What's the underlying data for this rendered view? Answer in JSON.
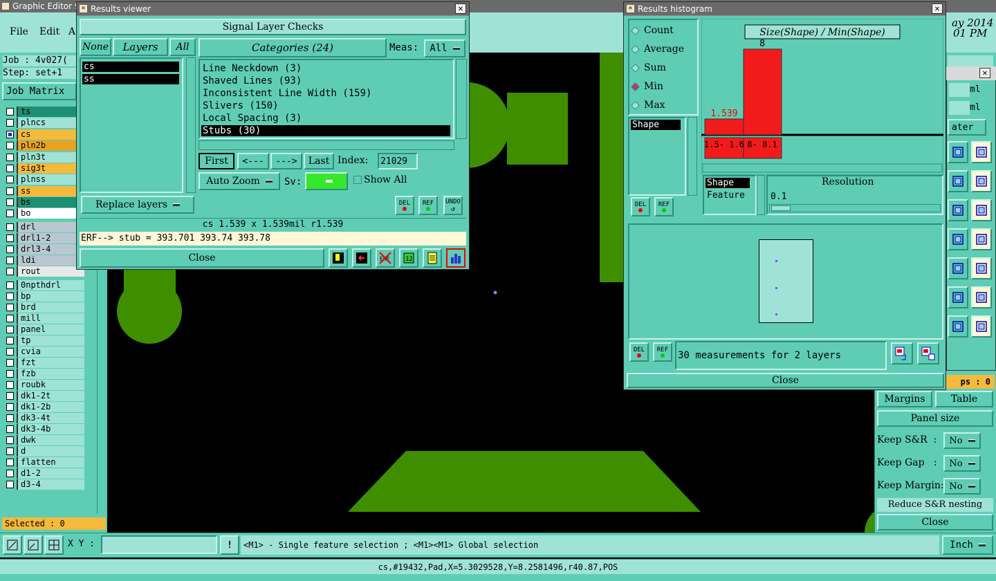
{
  "main": {
    "title": "Graphic Editor 9",
    "menu": [
      "File",
      "Edit",
      "A"
    ],
    "job": "Job : 4v027(",
    "step": "Step: set+1",
    "job_matrix": "Job Matrix",
    "selected": "Selected : 0",
    "date_fragment": "ay 2014",
    "time_fragment": "01 PM",
    "layers": [
      {
        "name": "ts",
        "color": "#1f8f73",
        "checked": false
      },
      {
        "name": "plncs",
        "color": "#9ee3d6",
        "checked": false
      },
      {
        "name": "cs",
        "color": "#f5b93c",
        "checked": true
      },
      {
        "name": "pln2b",
        "color": "#e8a323",
        "checked": false
      },
      {
        "name": "pln3t",
        "color": "#9ee3d6",
        "checked": false
      },
      {
        "name": "sig3t",
        "color": "#f5b93c",
        "checked": false
      },
      {
        "name": "plnss",
        "color": "#9ee3d6",
        "checked": false
      },
      {
        "name": "ss",
        "color": "#f5b93c",
        "checked": false
      },
      {
        "name": "bs",
        "color": "#1f8f73",
        "checked": false
      },
      {
        "name": "bo",
        "color": "#ffffff",
        "checked": false
      },
      {
        "name": "drl",
        "color": "#b9c8d0",
        "checked": false
      },
      {
        "name": "drl1-2",
        "color": "#b9c8d0",
        "checked": false
      },
      {
        "name": "drl3-4",
        "color": "#b9c8d0",
        "checked": false
      },
      {
        "name": "ldi",
        "color": "#b9c8d0",
        "checked": false
      },
      {
        "name": "rout",
        "color": "#e8e8e8",
        "checked": false
      },
      {
        "name": "0npthdrl",
        "color": "#9ee3d6",
        "checked": false
      },
      {
        "name": "bp",
        "color": "#9ee3d6",
        "checked": false
      },
      {
        "name": "brd",
        "color": "#9ee3d6",
        "checked": false
      },
      {
        "name": "mill",
        "color": "#9ee3d6",
        "checked": false
      },
      {
        "name": "panel",
        "color": "#9ee3d6",
        "checked": false
      },
      {
        "name": "tp",
        "color": "#9ee3d6",
        "checked": false
      },
      {
        "name": "cvia",
        "color": "#9ee3d6",
        "checked": false
      },
      {
        "name": "fzt",
        "color": "#9ee3d6",
        "checked": false
      },
      {
        "name": "fzb",
        "color": "#9ee3d6",
        "checked": false
      },
      {
        "name": "roubk",
        "color": "#9ee3d6",
        "checked": false
      },
      {
        "name": "dk1-2t",
        "color": "#9ee3d6",
        "checked": false
      },
      {
        "name": "dk1-2b",
        "color": "#9ee3d6",
        "checked": false
      },
      {
        "name": "dk3-4t",
        "color": "#9ee3d6",
        "checked": false
      },
      {
        "name": "dk3-4b",
        "color": "#9ee3d6",
        "checked": false
      },
      {
        "name": "dwk",
        "color": "#9ee3d6",
        "checked": false
      },
      {
        "name": "d",
        "color": "#9ee3d6",
        "checked": false
      },
      {
        "name": "flatten",
        "color": "#9ee3d6",
        "checked": false
      },
      {
        "name": "d1-2",
        "color": "#9ee3d6",
        "checked": false
      },
      {
        "name": "d3-4",
        "color": "#9ee3d6",
        "checked": false
      }
    ],
    "xy_label": "X Y :",
    "xy_value": "",
    "hint": "<M1> - Single feature selection ; <M1><M1> Global selection",
    "units": "Inch",
    "status": "cs,#19432,Pad,X=5.3029528,Y=8.2581496,r40.87,POS"
  },
  "results_viewer": {
    "title": "Results viewer",
    "header": "Signal Layer Checks",
    "none_btn": "None",
    "layers_btn": "Layers",
    "all_btn": "All",
    "categories_btn": "Categories (24)",
    "meas_label": "Meas:",
    "meas_value": "All",
    "layers": [
      "cs",
      "ss"
    ],
    "categories": [
      "Line Neckdown (3)",
      "Shaved Lines (93)",
      "Inconsistent Line Width (159)",
      "Slivers (150)",
      "Local Spacing (3)",
      "Stubs (30)"
    ],
    "selected_category": 5,
    "first": "First",
    "prev": "<---",
    "next": "--->",
    "last": "Last",
    "index_label": "Index:",
    "index_value": "21029",
    "auto_zoom": "Auto Zoom",
    "sv_label": "Sv:",
    "show_all": "Show All",
    "replace_layers": "Replace layers",
    "info_line": "cs 1.539 x 1.539mil  r1.539",
    "erf_line": "ERF--> stub = 393.701 393.74 393.78",
    "close": "Close",
    "del": "DEL",
    "ref": "REF",
    "undo": "UNDO"
  },
  "histogram": {
    "title": "Results histogram",
    "modes": [
      "Count",
      "Average",
      "Sum",
      "Min",
      "Max"
    ],
    "selected_mode": 3,
    "chart_title": "Size(Shape) / Min(Shape)",
    "bars": [
      {
        "label": "1.539",
        "range": "1.5- 1.6"
      },
      {
        "label": "8",
        "range": "8- 8.1"
      }
    ],
    "list_shape": "Shape",
    "attrs": [
      "Shape",
      "Feature"
    ],
    "resolution_label": "Resolution",
    "resolution_value": "0.1",
    "summary": "30 measurements for 2 layers",
    "close": "Close",
    "del": "DEL",
    "ref": "REF"
  },
  "right_panel": {
    "ml1": "ml",
    "ml2": "ml",
    "ater": "ater",
    "ps_label": "ps : 0",
    "margins": "Margins",
    "table": "Table",
    "panel_size": "Panel size",
    "keep_sr": "Keep S&R",
    "keep_gap": "Keep Gap",
    "keep_margin": "Keep Margin:",
    "no": "No",
    "reduce": "Reduce S&R nesting",
    "close": "Close"
  }
}
